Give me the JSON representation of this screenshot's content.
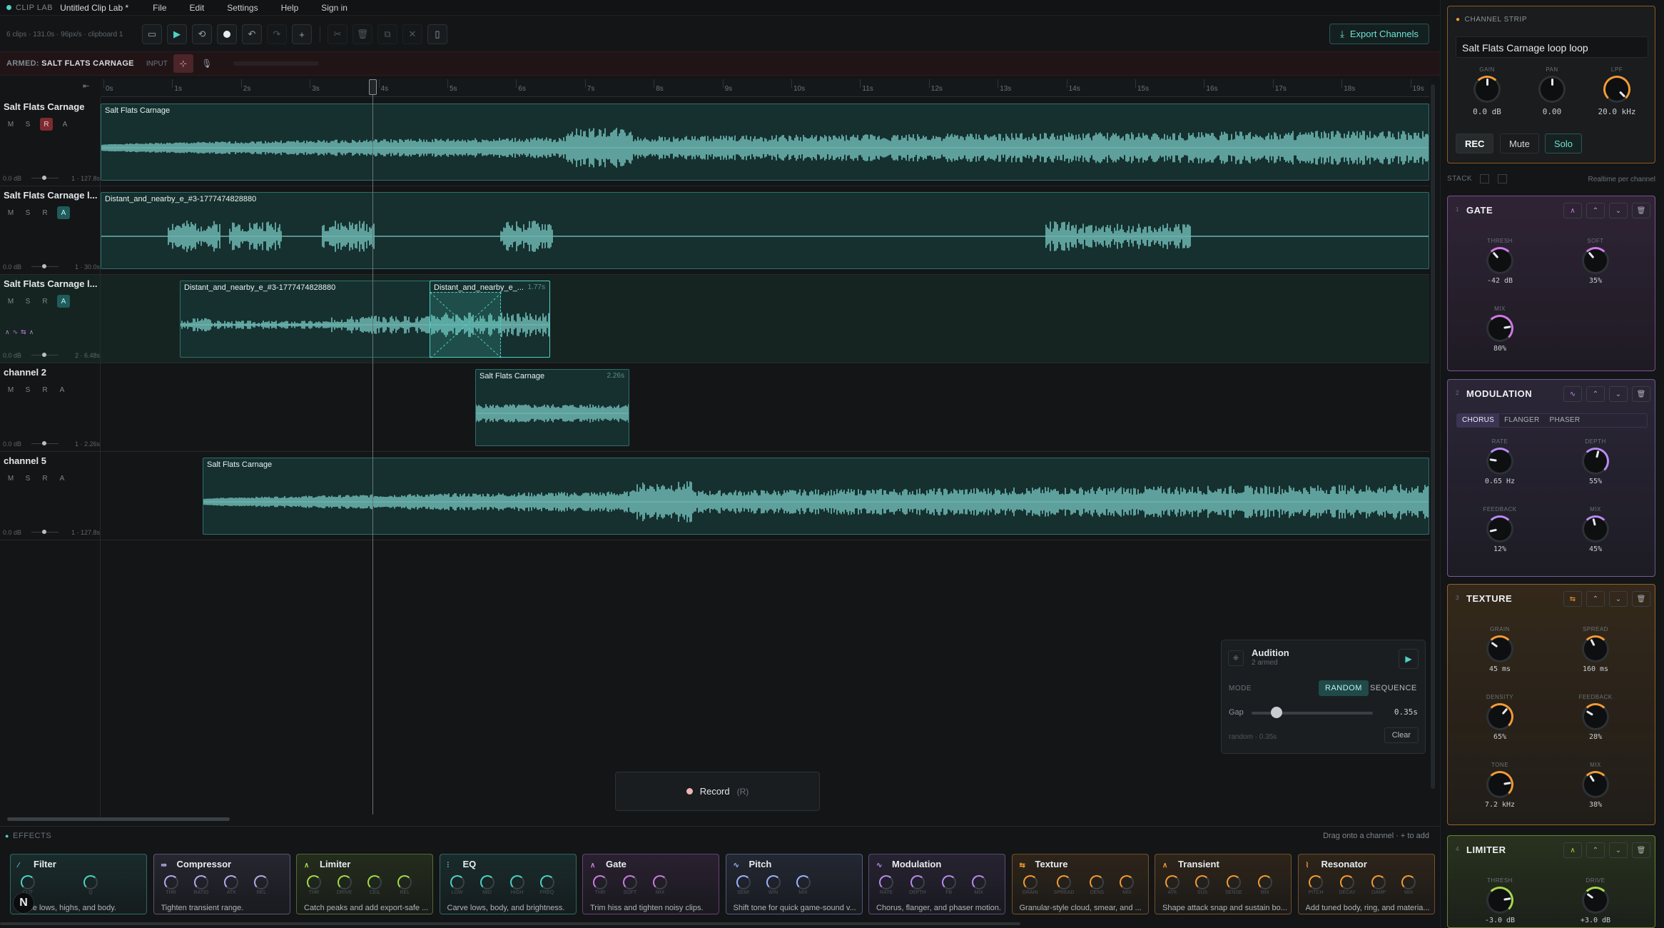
{
  "menubar": {
    "brand": "CLIP LAB",
    "title": "Untitled Clip Lab *",
    "menus": [
      "File",
      "Edit",
      "Settings",
      "Help",
      "Sign in"
    ]
  },
  "toolbar": {
    "info": "6 clips · 131.0s · 96px/s · clipboard 1",
    "export_label": "Export Channels"
  },
  "armbar": {
    "armed_prefix": "ARMED:",
    "armed_channel": "SALT FLATS CARNAGE",
    "input_label": "INPUT"
  },
  "ruler": {
    "start": "0",
    "ticks": [
      "0s",
      "1s",
      "2s",
      "3s",
      "4s",
      "5s",
      "6s",
      "7s",
      "8s",
      "9s",
      "10s",
      "11s",
      "12s",
      "13s",
      "14s",
      "15s",
      "16s",
      "17s",
      "18s",
      "19s"
    ]
  },
  "tracks": [
    {
      "name": "Salt Flats Carnage",
      "gain": "0.0 dB",
      "info": "1 · 127.8s",
      "r_state": "armed",
      "a_state": "off",
      "clips": [
        {
          "title": "Salt Flats Carnage",
          "duration": ""
        }
      ]
    },
    {
      "name": "Salt Flats Carnage l...",
      "gain": "0.0 dB",
      "info": "1 · 30.0s",
      "r_state": "off",
      "a_state": "on",
      "clips": [
        {
          "title": "Distant_and_nearby_e_#3-1777474828880",
          "duration": ""
        }
      ]
    },
    {
      "name": "Salt Flats Carnage l...",
      "gain": "0.0 dB",
      "info": "2 · 6.48s",
      "r_state": "off",
      "a_state": "on",
      "fx_icons": "∧∿⇆∧",
      "clips": [
        {
          "title": "Distant_and_nearby_e_#3-1777474828880",
          "duration": ""
        },
        {
          "title": "Distant_and_nearby_e_...",
          "duration": "1.77s"
        }
      ]
    },
    {
      "name": "channel 2",
      "gain": "0.0 dB",
      "info": "1 · 2.26s",
      "r_state": "off",
      "a_state": "off",
      "clips": [
        {
          "title": "Salt Flats Carnage",
          "duration": "2.26s"
        }
      ]
    },
    {
      "name": "channel 5",
      "gain": "0.0 dB",
      "info": "1 · 127.8s",
      "r_state": "off",
      "a_state": "off",
      "clips": [
        {
          "title": "Salt Flats Carnage",
          "duration": ""
        }
      ]
    }
  ],
  "track_buttons": {
    "m": "M",
    "s": "S",
    "r": "R",
    "a": "A"
  },
  "audition": {
    "title": "Audition",
    "subtitle": "2 armed",
    "mode_label": "MODE",
    "random": "RANDOM",
    "sequence": "SEQUENCE",
    "gap_label": "Gap",
    "gap_value": "0.35s",
    "gap_fraction": 0.12,
    "footer": "random · 0.35s",
    "clear": "Clear"
  },
  "record": {
    "label": "Record",
    "shortcut": "(R)"
  },
  "effects": {
    "header": "EFFECTS",
    "hint": "Drag onto a channel · + to add",
    "cards": [
      {
        "name": "Filter",
        "knobs": [
          "CUT",
          "Q"
        ],
        "desc": "Tame lows, highs, and body.",
        "color": "#4fd1c5"
      },
      {
        "name": "Compressor",
        "knobs": [
          "THR",
          "RATIO",
          "ATK",
          "REL"
        ],
        "desc": "Tighten transient range.",
        "color": "#b7a8e8"
      },
      {
        "name": "Limiter",
        "knobs": [
          "THR",
          "DRIVE",
          "CEIL",
          "REL"
        ],
        "desc": "Catch peaks and add export-safe ...",
        "color": "#a6d94a"
      },
      {
        "name": "EQ",
        "knobs": [
          "LOW",
          "MID",
          "HIGH",
          "FREQ"
        ],
        "desc": "Carve lows, body, and brightness.",
        "color": "#4fd1c5"
      },
      {
        "name": "Gate",
        "knobs": [
          "THR",
          "SOFT",
          "MIX"
        ],
        "desc": "Trim hiss and tighten noisy clips.",
        "color": "#d07ae6"
      },
      {
        "name": "Pitch",
        "knobs": [
          "SEMI",
          "WIN",
          "MIX"
        ],
        "desc": "Shift tone for quick game-sound v...",
        "color": "#9fb2ff"
      },
      {
        "name": "Modulation",
        "knobs": [
          "RATE",
          "DEPTH",
          "FB",
          "MIX"
        ],
        "desc": "Chorus, flanger, and phaser motion.",
        "color": "#b98bf2"
      },
      {
        "name": "Texture",
        "knobs": [
          "GRAIN",
          "SPREAD",
          "DENS",
          "MIX"
        ],
        "desc": "Granular-style cloud, smear, and ...",
        "color": "#f39b35"
      },
      {
        "name": "Transient",
        "knobs": [
          "ATK",
          "SUS",
          "SENSE",
          "MIX"
        ],
        "desc": "Shape attack snap and sustain bo...",
        "color": "#f39b35"
      },
      {
        "name": "Resonator",
        "knobs": [
          "PITCH",
          "DECAY",
          "DAMP",
          "MIX"
        ],
        "desc": "Add tuned body, ring, and materia...",
        "color": "#f39b35"
      }
    ]
  },
  "channel_strip": {
    "header": "CHANNEL STRIP",
    "name": "Salt Flats Carnage loop loop",
    "gain_label": "GAIN",
    "gain": "0.0 dB",
    "pan_label": "PAN",
    "pan": "0.00",
    "lpf_label": "LPF",
    "lpf": "20.0 kHz",
    "rec": "REC",
    "mute": "Mute",
    "solo": "Solo"
  },
  "stack": {
    "label": "STACK",
    "right": "Realtime per channel"
  },
  "modules": [
    {
      "index": "1",
      "title": "GATE",
      "color": "#d07ae6",
      "params": [
        {
          "label": "THRESH",
          "value": "-42 dB",
          "level": 0.35
        },
        {
          "label": "SOFT",
          "value": "35%",
          "level": 0.35
        },
        {
          "label": "MIX",
          "value": "80%",
          "level": 0.8
        }
      ]
    },
    {
      "index": "2",
      "title": "MODULATION",
      "color": "#b98bf2",
      "tabs": [
        "CHORUS",
        "FLANGER",
        "PHASER"
      ],
      "params": [
        {
          "label": "RATE",
          "value": "0.65 Hz",
          "level": 0.2
        },
        {
          "label": "DEPTH",
          "value": "55%",
          "level": 0.55
        },
        {
          "label": "FEEDBACK",
          "value": "12%",
          "level": 0.12
        },
        {
          "label": "MIX",
          "value": "45%",
          "level": 0.45
        }
      ]
    },
    {
      "index": "3",
      "title": "TEXTURE",
      "color": "#f39b35",
      "params": [
        {
          "label": "GRAIN",
          "value": "45 ms",
          "level": 0.3
        },
        {
          "label": "SPREAD",
          "value": "160 ms",
          "level": 0.4
        },
        {
          "label": "DENSITY",
          "value": "65%",
          "level": 0.65
        },
        {
          "label": "FEEDBACK",
          "value": "28%",
          "level": 0.28
        },
        {
          "label": "TONE",
          "value": "7.2 kHz",
          "level": 0.8
        },
        {
          "label": "MIX",
          "value": "38%",
          "level": 0.38
        }
      ]
    },
    {
      "index": "4",
      "title": "LIMITER",
      "color": "#a6d94a",
      "params": [
        {
          "label": "THRESH",
          "value": "-3.0 dB",
          "level": 0.8
        },
        {
          "label": "DRIVE",
          "value": "+3.0 dB",
          "level": 0.3
        }
      ]
    }
  ]
}
